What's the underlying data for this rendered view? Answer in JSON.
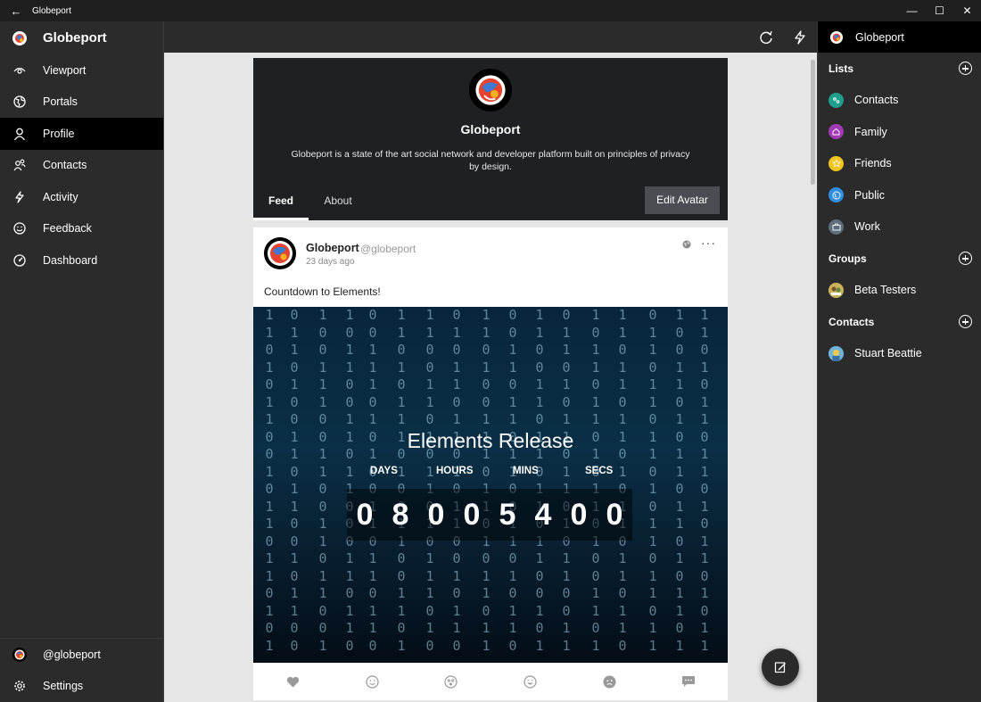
{
  "window": {
    "title": "Globeport",
    "controls": {
      "minimize": "—",
      "maximize": "☐",
      "close": "✕"
    }
  },
  "sidebar": {
    "brand": "Globeport",
    "items": [
      {
        "label": "Viewport",
        "icon": "eye-icon"
      },
      {
        "label": "Portals",
        "icon": "globe-icon"
      },
      {
        "label": "Profile",
        "icon": "person-icon",
        "active": true
      },
      {
        "label": "Contacts",
        "icon": "contacts-icon"
      },
      {
        "label": "Activity",
        "icon": "lightning-icon"
      },
      {
        "label": "Feedback",
        "icon": "smiley-icon"
      },
      {
        "label": "Dashboard",
        "icon": "dashboard-icon"
      }
    ],
    "bottom": [
      {
        "label": "@globeport",
        "icon": "avatar"
      },
      {
        "label": "Settings",
        "icon": "gear-icon"
      }
    ]
  },
  "header": {
    "icons": [
      "refresh-icon",
      "lightning-icon"
    ]
  },
  "profile": {
    "name": "Globeport",
    "description": "Globeport is a state of the art social network and developer platform built on principles of privacy by design.",
    "tabs": [
      "Feed",
      "About"
    ],
    "edit_avatar": "Edit Avatar"
  },
  "post": {
    "author": "Globeport",
    "handle": "@globeport",
    "time": "23 days ago",
    "more": "···",
    "text": "Countdown to Elements!",
    "countdown": {
      "title": "Elements Release",
      "labels": [
        "DAYS",
        "HOURS",
        "MINS",
        "SECS"
      ],
      "digits": [
        "0",
        "8",
        "0",
        "0",
        "5",
        "4",
        "0",
        "0"
      ]
    },
    "reactions": [
      "heart-icon",
      "smile-icon",
      "surprised-icon",
      "laugh-icon",
      "sad-icon",
      "comment-icon"
    ]
  },
  "rightpanel": {
    "head": "Globeport",
    "lists_title": "Lists",
    "lists": [
      {
        "label": "Contacts",
        "color": "#1e9e8c"
      },
      {
        "label": "Family",
        "color": "#a23ab8"
      },
      {
        "label": "Friends",
        "color": "#f0c419"
      },
      {
        "label": "Public",
        "color": "#2f8ee0"
      },
      {
        "label": "Work",
        "color": "#5e6e7e"
      }
    ],
    "groups_title": "Groups",
    "groups": [
      {
        "label": "Beta Testers"
      }
    ],
    "contacts_title": "Contacts",
    "contacts": [
      {
        "label": "Stuart Beattie"
      }
    ]
  }
}
